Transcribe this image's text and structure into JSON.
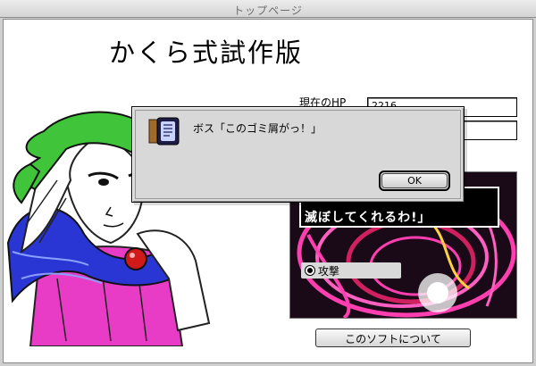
{
  "window": {
    "title": "トップページ"
  },
  "app": {
    "title": "かくら式試作版"
  },
  "status": {
    "hp_label": "現在のHP",
    "hp_value": "2216",
    "second_value": ""
  },
  "battle": {
    "enemy_line": "滅ぼしてくれるわ!」",
    "command_attack": "攻撃"
  },
  "about_button": "このソフトについて",
  "dialog": {
    "message": "ボス「このゴミ屑がっ！」",
    "ok_label": "OK",
    "icon": "note-icon"
  },
  "colors": {
    "bandana": "#3fc43a",
    "cloak": "#2233cc",
    "coat": "#e040c0",
    "gem": "#d01a1a",
    "battle_glow": "#ff3fb0"
  }
}
